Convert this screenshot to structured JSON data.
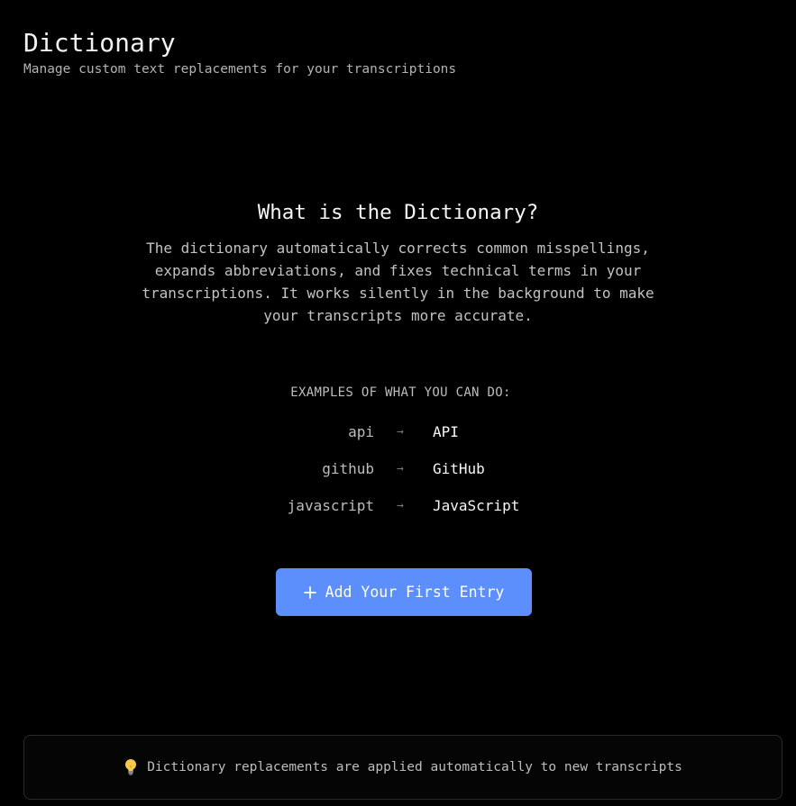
{
  "header": {
    "title": "Dictionary",
    "subtitle": "Manage custom text replacements for your transcriptions"
  },
  "intro": {
    "heading": "What is the Dictionary?",
    "description": "The dictionary automatically corrects common misspellings, expands abbreviations, and fixes technical terms in your transcriptions. It works silently in the background to make your transcripts more accurate."
  },
  "examples": {
    "label": "EXAMPLES OF WHAT YOU CAN DO:",
    "arrow_glyph": "→",
    "items": [
      {
        "from": "api",
        "to": "API"
      },
      {
        "from": "github",
        "to": "GitHub"
      },
      {
        "from": "javascript",
        "to": "JavaScript"
      }
    ]
  },
  "actions": {
    "add_first_entry_label": "Add Your First Entry",
    "add_icon": "plus-icon"
  },
  "info": {
    "icon": "lightbulb-icon",
    "text": "Dictionary replacements are applied automatically to new transcripts"
  },
  "colors": {
    "background": "#000000",
    "accent": "#5c8ffc",
    "text_primary": "#f2f2f2",
    "text_secondary": "#b3b3b3"
  }
}
